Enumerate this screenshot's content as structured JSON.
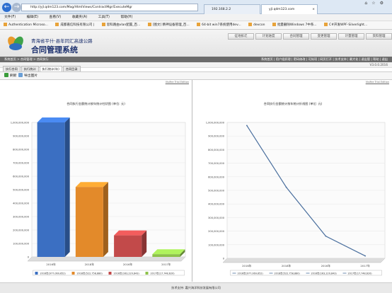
{
  "browser": {
    "url": "http://yjl.qdm123.com/Mag/HtmlViews/ContractMgr/ExecuteMgr",
    "tabs": [
      {
        "title": "192.168.2.2"
      },
      {
        "title": "yjl.qdm123.com"
      }
    ],
    "menu": [
      "文件(F)",
      "编辑(E)",
      "查看(V)",
      "收藏夹(A)",
      "工具(T)",
      "帮助(H)"
    ],
    "favorites": [
      "Authentication Microso...",
      "成都嘉信科技有限公司 |",
      "思科路由vlan配置_百...",
      "[图文] 精神设备管理_百...",
      "64-bit win7系统使用dev...",
      "devcon",
      "批量删除Windows 7中系...",
      "C#开发WPF-Silverlight..."
    ]
  },
  "header": {
    "subtitle": "青海省平什·县年同汇高速公路",
    "title": "合同管理系统",
    "nav": [
      "征地拆迁",
      "计划进度",
      "合同管理",
      "变更管理",
      "计量管理",
      "资料管理"
    ]
  },
  "breadcrumb": {
    "left": "系统首页 > 合同管理 > 合同执行",
    "right": "系统首页 | 用户组织理 | 密码修改 | 可拟项 | 网页打开 | 技术支持 | 最大化 | 退出管 | 帮助 | 退出"
  },
  "version": "V3.0.0.2016",
  "page_tabs": [
    {
      "label": "执行合同",
      "active": false
    },
    {
      "label": "执行统计",
      "active": false
    },
    {
      "label": "执行统计(年)",
      "active": true
    },
    {
      "label": "合同目录",
      "active": false
    }
  ],
  "toolbar": {
    "refresh": "刷新",
    "export": "导出图片"
  },
  "colors": {
    "bar": [
      "#3b6fc2",
      "#e38a2a",
      "#c24a4a",
      "#8dc24a"
    ],
    "line": "#4a6f9e"
  },
  "left_chart_title": "合同执行金额统计按年统计柱状图 (单位: 元)",
  "right_chart_title": "合同执行金额统计按年统计折线图 (单位: 元)",
  "chart_data": [
    {
      "type": "bar",
      "title": "合同执行金额统计按年统计柱状图 (单位: 元)",
      "categories": [
        "2016年",
        "2018年",
        "2016年",
        "2017年"
      ],
      "values": [
        1000000000,
        520000000,
        160000000,
        20000000
      ],
      "ylim": [
        0,
        1000000000
      ],
      "yticks": [
        "0",
        "100,000,000",
        "200,000,000",
        "300,000,000",
        "400,000,000",
        "500,000,000",
        "600,000,000",
        "700,000,000",
        "800,000,000",
        "900,000,000",
        "1,000,000,000"
      ],
      "legend": [
        "2016年(977,069,652)",
        "2018年(522,758,880)",
        "2016年(163,220,843)",
        "2017年(17,748,620)"
      ],
      "grid": true,
      "legend_position": "bottom"
    },
    {
      "type": "line",
      "title": "合同执行金额统计按年统计折线图 (单位: 元)",
      "categories": [
        "2016年",
        "2018年",
        "2016年",
        "2017年"
      ],
      "values": [
        977069652,
        522758880,
        163220843,
        17748620
      ],
      "ylim": [
        0,
        1000000000
      ],
      "yticks": [
        "0",
        "100,000,000",
        "200,000,000",
        "300,000,000",
        "400,000,000",
        "500,000,000",
        "600,000,000",
        "700,000,000",
        "800,000,000",
        "900,000,000",
        "1,000,000,000"
      ],
      "legend": [
        "2016年(977,069,652)",
        "2018年(522,758,880)",
        "2016年(163,220,843)",
        "2017年(17,748,620)"
      ],
      "grid": true,
      "legend_position": "bottom"
    }
  ],
  "vt_label": "Visifire Trial Edition",
  "footer": "技术支持: 嘉兴海洋科技发展有限公司"
}
